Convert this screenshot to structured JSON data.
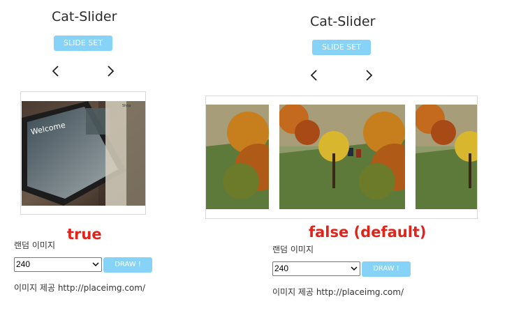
{
  "left_panel": {
    "title": "Cat-Slider",
    "slide_set_label": "SLIDE SET",
    "prev_icon": "chevron-left-icon",
    "next_icon": "chevron-right-icon",
    "mode_label": "true",
    "random_label": "랜덤 이미지",
    "select_value": "240",
    "draw_label": "DRAW !",
    "credit": "이미지 제공 http://placeimg.com/",
    "image_overlay_text": "Welcome",
    "image_corner_text": "Shop"
  },
  "right_panel": {
    "title": "Cat-Slider",
    "slide_set_label": "SLIDE SET",
    "prev_icon": "chevron-left-icon",
    "next_icon": "chevron-right-icon",
    "mode_label": "false (default)",
    "random_label": "랜덤 이미지",
    "select_value": "240",
    "draw_label": "DRAW !",
    "credit": "이미지 제공 http://placeimg.com/"
  },
  "colors": {
    "accent": "#87d3f8",
    "mode_label": "#e0241b",
    "frame_border": "#d9d9d9"
  }
}
